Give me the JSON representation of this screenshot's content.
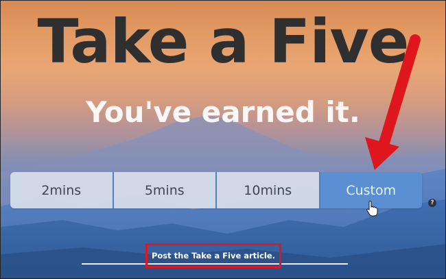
{
  "page": {
    "title": "Take a Five",
    "subtitle": "You've earned it."
  },
  "durations": [
    {
      "label": "2mins"
    },
    {
      "label": "5mins"
    },
    {
      "label": "10mins"
    },
    {
      "label": "Custom"
    }
  ],
  "help": {
    "icon": "question-icon",
    "label": "?"
  },
  "footer": {
    "link_label": "Post the Take a Five article."
  },
  "colors": {
    "title": "#2f2f2f",
    "subtitle": "#ffffff",
    "option_bg": "#d6dee8",
    "custom_bg": "#5a90d2",
    "annotation_red": "#e0161e"
  },
  "annotations": {
    "arrow_icon": "red-arrow-icon",
    "cursor_icon": "hand-cursor-icon"
  }
}
